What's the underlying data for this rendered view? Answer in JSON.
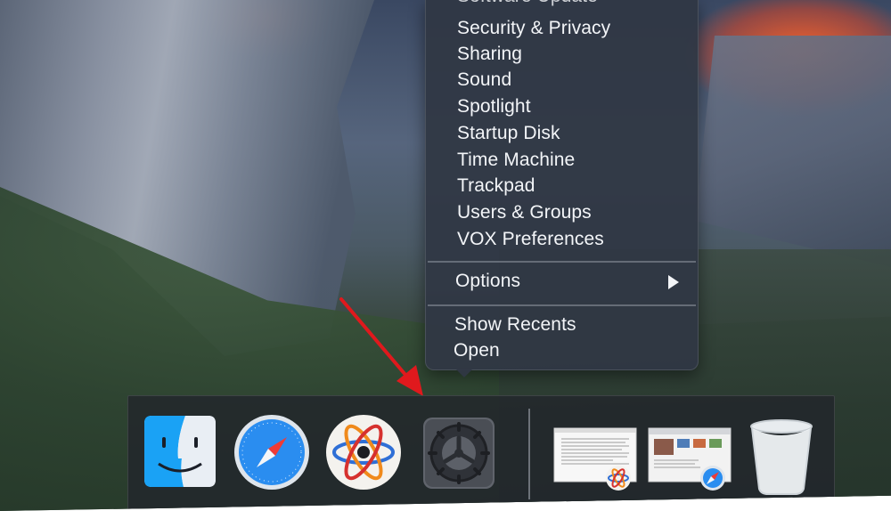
{
  "menu": {
    "clipped_top_item": "Software Update",
    "items": [
      "Security & Privacy",
      "Sharing",
      "Sound",
      "Spotlight",
      "Startup Disk",
      "Time Machine",
      "Trackpad",
      "Users & Groups",
      "VOX Preferences"
    ],
    "options_label": "Options",
    "show_recents_label": "Show Recents",
    "open_label": "Open"
  },
  "dock": {
    "apps": [
      {
        "icon": "finder-icon"
      },
      {
        "icon": "safari-icon"
      },
      {
        "icon": "atom-app-icon"
      },
      {
        "icon": "system-preferences-icon"
      }
    ],
    "minimized": [
      {
        "icon": "document-window-thumbnail"
      },
      {
        "icon": "browser-window-thumbnail"
      }
    ],
    "trash_icon": "trash-icon"
  },
  "colors": {
    "menu_bg": "#30374a",
    "annotation_arrow": "#e0191d",
    "accent_sunset": "#ff6228"
  }
}
